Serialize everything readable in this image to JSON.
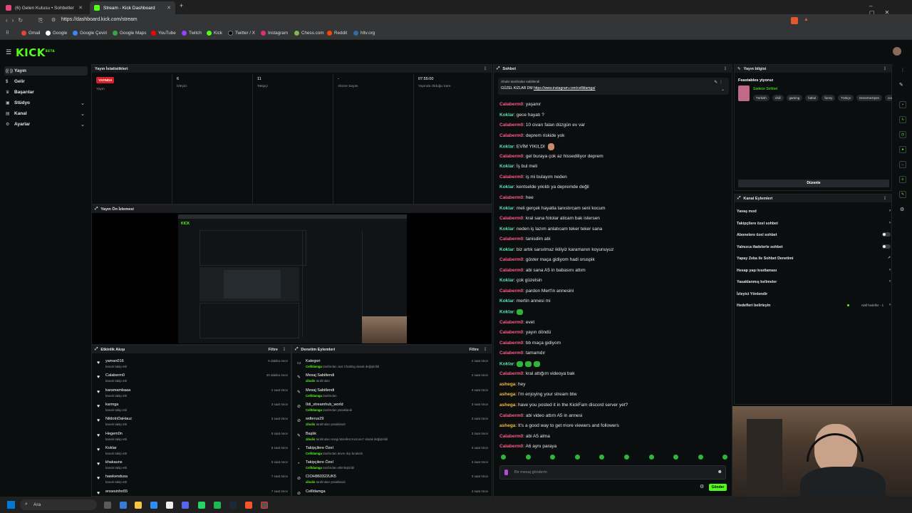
{
  "browser": {
    "tabs": [
      {
        "label": "(6) Gelen Kutusu • Sohbetler",
        "active": false,
        "color": "#e8457d"
      },
      {
        "label": "Stream - Kick Dashboard",
        "active": true,
        "color": "#53fc18"
      }
    ],
    "url": "https://dashboard.kick.com/stream",
    "bookmarks": [
      "Gmail",
      "Google",
      "Google Çeviri",
      "Google Maps",
      "YouTube",
      "Twitch",
      "Kick",
      "Twitter / X",
      "Instagram",
      "Chess.com",
      "Reddit",
      "hltv.org"
    ]
  },
  "app": {
    "logo": "KICK",
    "logo_sup": "BETA",
    "accent": "#53fc18"
  },
  "sidebar": {
    "items": [
      {
        "label": "Yayın",
        "active": true,
        "chevron": false
      },
      {
        "label": "Gelir",
        "active": false,
        "chevron": false
      },
      {
        "label": "Başarılar",
        "active": false,
        "chevron": false
      },
      {
        "label": "Stüdyo",
        "active": false,
        "chevron": true
      },
      {
        "label": "Kanal",
        "active": false,
        "chevron": true
      },
      {
        "label": "Ayarlar",
        "active": false,
        "chevron": true
      }
    ]
  },
  "stats": {
    "title": "Yayın İstatistikleri",
    "badge": "YAYINDA",
    "items": [
      {
        "value": "",
        "label": "Yayın"
      },
      {
        "value": "6",
        "label": "İzleyici"
      },
      {
        "value": "11",
        "label": "Takipçi"
      },
      {
        "value": "-",
        "label": "Abone Sayısı"
      },
      {
        "value": "07:55:00",
        "label": "Yayında Olduğu Süre"
      }
    ]
  },
  "preview": {
    "title": "Yayın Ön İzlemesi"
  },
  "activity": {
    "title": "Etkinlik Akışı",
    "filter": "Filtre",
    "rows": [
      {
        "name": "yaman016",
        "sub": "kanalı takip etti",
        "time": "5 dakika önce"
      },
      {
        "name": "Calaberm0",
        "sub": "kanalı takip etti",
        "time": "20 dakika önce"
      },
      {
        "name": "karamambaaa",
        "sub": "kanalı takip etti",
        "time": "2 saat önce"
      },
      {
        "name": "karmga",
        "sub": "kanalı takip etti",
        "time": "3 saat önce"
      },
      {
        "name": "NildoInDaHauz",
        "sub": "kanalı takip etti",
        "time": "3 saat önce"
      },
      {
        "name": "Hegem0n",
        "sub": "kanalı takip etti",
        "time": "5 saat önce"
      },
      {
        "name": "Koklar",
        "sub": "kanalı takip etti",
        "time": "5 saat önce"
      },
      {
        "name": "khakauns",
        "sub": "kanalı takip etti",
        "time": "5 saat önce"
      },
      {
        "name": "hawkendusa",
        "sub": "kanalı takip etti",
        "time": "7 saat önce"
      },
      {
        "name": "ensesinho55",
        "sub": "",
        "time": "7 saat önce"
      }
    ]
  },
  "moderation": {
    "title": "Denetim Eylemleri",
    "filter": "Filtre",
    "rows": [
      {
        "icon": "▭",
        "name": "Kategori",
        "user": "Cellldamga",
        "sub": " tarafından Just Chatting olarak değiştirildi",
        "time": "2 saat önce"
      },
      {
        "icon": "✎",
        "name": "Mesaj Sabitlendi",
        "user": "zibulis",
        "sub": " tarafından",
        "time": "2 saat önce"
      },
      {
        "icon": "✎",
        "name": "Mesaj Sabitlendi",
        "user": "Cellldamga",
        "sub": " tarafından",
        "time": "3 saat önce"
      },
      {
        "icon": "⊘",
        "name": "0di_streamhub_world",
        "user": "Cellldamga",
        "sub": " tarafından yasaklandı",
        "time": "3 saat önce"
      },
      {
        "icon": "⊘",
        "name": "wdterus29",
        "user": "zibulis",
        "sub": " tarafından yasaklandı",
        "time": "3 saat önce"
      },
      {
        "icon": "✎",
        "name": "Başlık",
        "user": "zibulis",
        "sub": " tarafından Hangi Manifest Kozunu? olarak değiştirildi",
        "time": "3 saat önce"
      },
      {
        "icon": "◔",
        "name": "Takipçilere Özel",
        "user": "Cellldamga",
        "sub": " tarafından devre dışı bırakıldı",
        "time": "3 saat önce"
      },
      {
        "icon": "◔",
        "name": "Takipçilere Özel",
        "user": "Cellldamga",
        "sub": " tarafından etkinleştirildi",
        "time": "3 saat önce"
      },
      {
        "icon": "⊘",
        "name": "CIOH860322UK5",
        "user": "zibulis",
        "sub": " tarafından yasaklandı",
        "time": "3 saat önce"
      },
      {
        "icon": "⊘",
        "name": "Cellldamga",
        "user": "",
        "sub": "",
        "time": "4 saat önce"
      }
    ]
  },
  "chat": {
    "title": "Sohbet",
    "pinned_by": "zibulis tarafından sabitlendi",
    "pinned_text": "GÜZEL KIZLAR DM",
    "pinned_link": "https://www.instagram.com/cellldamga/",
    "messages": [
      {
        "user": "Calaberm0",
        "color": "#ff5c8a",
        "text": "yaşanır"
      },
      {
        "user": "Koklar",
        "color": "#59e3b4",
        "text": "gece hayatı ?"
      },
      {
        "user": "Calaberm0",
        "color": "#ff5c8a",
        "text": "10 civarı falan düzgün ev var"
      },
      {
        "user": "Calaberm0",
        "color": "#ff5c8a",
        "text": "deprem riskide yok"
      },
      {
        "user": "Koklar",
        "color": "#59e3b4",
        "text": "EVİM YIKILDI"
      },
      {
        "user": "Calaberm0",
        "color": "#ff5c8a",
        "text": "gel buraya çok az hissediliyor deprem"
      },
      {
        "user": "Koklar",
        "color": "#59e3b4",
        "text": "İş bul meli"
      },
      {
        "user": "Calaberm0",
        "color": "#ff5c8a",
        "text": "iş mi bulayım neden"
      },
      {
        "user": "Koklar",
        "color": "#59e3b4",
        "text": "kentselde yıkıldı ya depremde değil"
      },
      {
        "user": "Calaberm0",
        "color": "#ff5c8a",
        "text": "hee"
      },
      {
        "user": "Koklar",
        "color": "#59e3b4",
        "text": "meli gerçek hayatla tanıstırcam seni kocum"
      },
      {
        "user": "Calaberm0",
        "color": "#ff5c8a",
        "text": "kral sana fotolar aticam bak istersen"
      },
      {
        "user": "Koklar",
        "color": "#59e3b4",
        "text": "neden iş lazım anlatıcam teker teker sana"
      },
      {
        "user": "Calaberm0",
        "color": "#ff5c8a",
        "text": "tanisdim abi"
      },
      {
        "user": "Koklar",
        "color": "#59e3b4",
        "text": "biz artık sarsılmaz ikiliyiz karamanın koyunuyuz"
      },
      {
        "user": "Calaberm0",
        "color": "#ff5c8a",
        "text": "göster maça gidiyom hadi oruspik"
      },
      {
        "user": "Calaberm0",
        "color": "#ff5c8a",
        "text": "abi sana A5 in babasını attım"
      },
      {
        "user": "Koklar",
        "color": "#59e3b4",
        "text": "çok güzelsin"
      },
      {
        "user": "Calaberm0",
        "color": "#ff5c8a",
        "text": "pardon Mert'in annesini"
      },
      {
        "user": "Koklar",
        "color": "#59e3b4",
        "text": "mertin annesi mi"
      },
      {
        "user": "Koklar",
        "color": "#59e3b4",
        "text": ""
      },
      {
        "user": "Calaberm0",
        "color": "#ff5c8a",
        "text": "evet"
      },
      {
        "user": "Calaberm0",
        "color": "#ff5c8a",
        "text": "yayın döndü"
      },
      {
        "user": "Calaberm0",
        "color": "#ff5c8a",
        "text": "bb maça gidiyom"
      },
      {
        "user": "Calaberm0",
        "color": "#ff5c8a",
        "text": "tamamdır"
      },
      {
        "user": "Koklar",
        "color": "#59e3b4",
        "text": ""
      },
      {
        "user": "Calaberm0",
        "color": "#ff5c8a",
        "text": "kral attığım videoya bak"
      },
      {
        "user": "ashega",
        "color": "#f5b942",
        "text": "hey"
      },
      {
        "user": "ashega",
        "color": "#f5b942",
        "text": "I'm enjoying your stream btw"
      },
      {
        "user": "ashega",
        "color": "#f5b942",
        "text": "have you posted it in the KickFam discord server yet?"
      },
      {
        "user": "Calaberm0",
        "color": "#ff5c8a",
        "text": "abi video attım A5 in annesi"
      },
      {
        "user": "ashega",
        "color": "#f5b942",
        "text": "It's a good way to get more viewers and followers"
      },
      {
        "user": "Calaberm0",
        "color": "#ff5c8a",
        "text": "abi A5 alma"
      },
      {
        "user": "Calaberm0",
        "color": "#ff5c8a",
        "text": "A6 aynı paraya"
      }
    ],
    "input_placeholder": "Bir mesaj gönderin",
    "send_label": "Gönder"
  },
  "stream_info": {
    "title": "Yayın bilgisi",
    "stream_title": "Feastables yiyoruz",
    "category": "Sadece Sohbet",
    "tags": [
      "Türkish",
      "chill",
      "gaming",
      "futbol",
      "funny",
      "Türkçe",
      "Deneme4Iyes",
      "counte"
    ],
    "edit_label": "Düzenle"
  },
  "channel_actions": {
    "title": "Kanal Eylemleri",
    "items": [
      {
        "label": "Yavaş mod",
        "control": "chevron"
      },
      {
        "label": "Takipçilere özel sohbet",
        "control": "chevron"
      },
      {
        "label": "Abonelere özel sohbet",
        "control": "toggle"
      },
      {
        "label": "Yalnızca ifadelerle sohbet",
        "control": "toggle"
      },
      {
        "label": "Yapay Zeka ile Sohbet Denetimi",
        "control": "external"
      },
      {
        "label": "Hesap yaşı kısıtlaması",
        "control": "chevron"
      },
      {
        "label": "Yasaklanmış kelimeler",
        "control": "chevron"
      },
      {
        "label": "İzleyici Yönlendir",
        "control": "none"
      },
      {
        "label": "Hedefleri belirleyin",
        "control": "chevron",
        "extra": "Aktif hedefler - 1"
      }
    ]
  },
  "taskbar": {
    "search": "Ara"
  }
}
